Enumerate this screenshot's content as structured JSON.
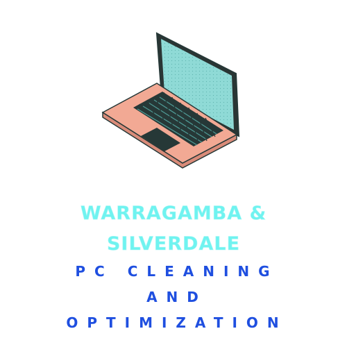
{
  "logo": {
    "icon": "laptop-icon",
    "colors": {
      "screen": "#8fdad6",
      "body": "#f2a994",
      "outline": "#263837",
      "keys": "#2b6f6c"
    }
  },
  "title": {
    "line1": "WARRAGAMBA &",
    "line2": "SILVERDALE"
  },
  "subtitle": {
    "line1": "PC CLEANING",
    "line2": "AND",
    "line3": "OPTIMIZATION"
  }
}
